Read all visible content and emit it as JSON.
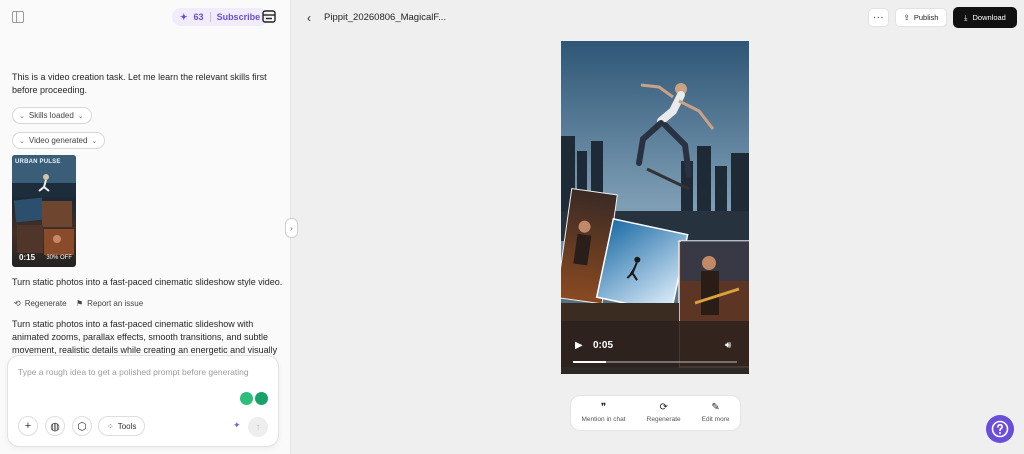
{
  "header": {
    "credits": "63",
    "subscribe_label": "Subscribe"
  },
  "chat": {
    "intro_text": "This is a video creation task. Let me learn the relevant skills first before proceeding.",
    "chips": [
      "Skills loaded",
      "Video generated"
    ],
    "thumbnail": {
      "title": "URBAN PULSE",
      "duration": "0:15",
      "badge": "30% OFF"
    },
    "result_text": "Turn static photos into a fast-paced cinematic slideshow style video.",
    "actions": {
      "regenerate": "Regenerate",
      "report": "Report an issue"
    },
    "detail_text": "Turn static photos into a fast-paced cinematic slideshow with animated zooms, parallax effects, smooth transitions, and subtle movement, realistic details while creating an energetic and visually appealing"
  },
  "composer": {
    "placeholder": "Type a rough idea to get a polished prompt before generating",
    "tools_label": "Tools"
  },
  "editor": {
    "filename": "Pippit_20260806_MagicalF...",
    "publish_label": "Publish",
    "download_label": "Download"
  },
  "player": {
    "current_time": "0:05",
    "progress": 0.2
  },
  "action_bar": {
    "mention": "Mention in chat",
    "regenerate": "Regenerate",
    "edit": "Edit more"
  },
  "colors": {
    "accent": "#6a4ed9",
    "subscribe_text": "#6b4fd1",
    "download_bg": "#111111"
  }
}
